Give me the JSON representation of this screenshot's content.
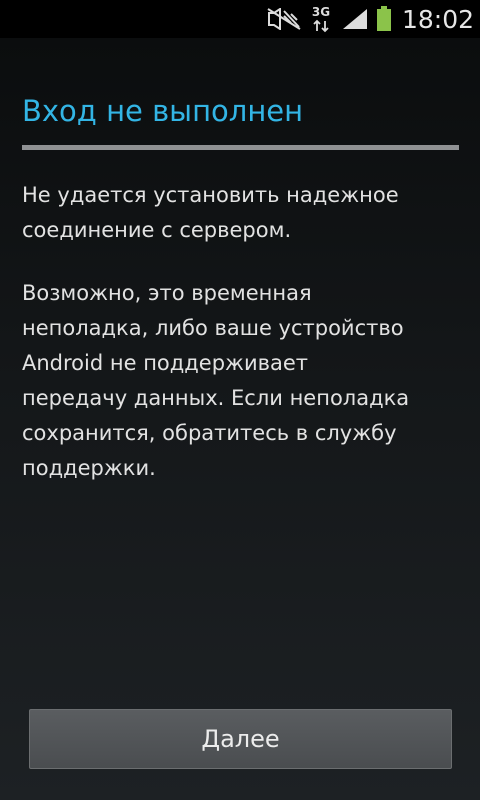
{
  "status_bar": {
    "icons": [
      "mute-icon",
      "3g-network-icon",
      "signal-icon",
      "battery-icon"
    ],
    "network_label": "3G",
    "time": "18:02",
    "battery_color": "#8bc34a"
  },
  "dialog": {
    "title": "Вход не выполнен",
    "paragraph_1": [
      "Не удается установить надежное",
      "соединение с сервером."
    ],
    "paragraph_2": [
      "Возможно, это временная",
      "неполадка, либо ваше устройство",
      "Android не поддерживает",
      "передачу данных. Если неполадка",
      "сохранится, обратитесь в службу",
      "поддержки."
    ]
  },
  "actions": {
    "next_label": "Далее"
  },
  "colors": {
    "title": "#33b5e5",
    "divider": "#8f9193",
    "body_text": "#e2e2e2",
    "button_bg": "#525558"
  }
}
